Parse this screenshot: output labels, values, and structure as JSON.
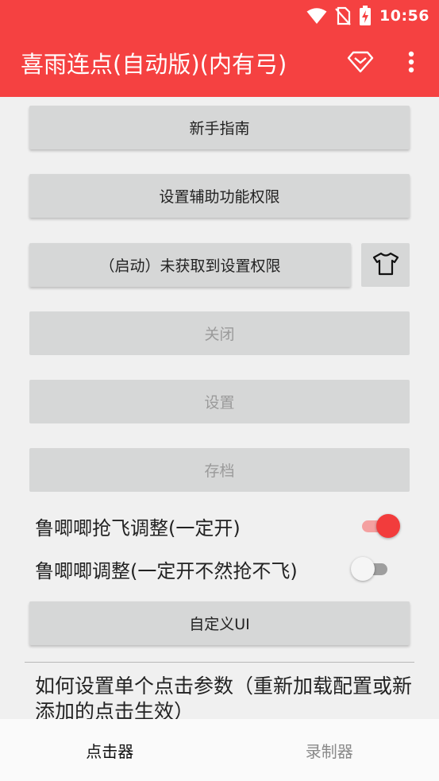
{
  "status_bar": {
    "time": "10:56",
    "icons": [
      "wifi-icon",
      "no-sim-icon",
      "battery-charging-icon"
    ]
  },
  "app_bar": {
    "title": "喜雨连点(自动版)(内有弓)",
    "actions": [
      "diamond-vip-icon",
      "more-vert-icon"
    ]
  },
  "buttons": {
    "guide": "新手指南",
    "accessibility": "设置辅助功能权限",
    "start": "（启动）未获取到设置权限",
    "close": "关闭",
    "settings": "设置",
    "archive": "存档",
    "custom_ui": "自定义UI"
  },
  "switches": [
    {
      "label": "鲁唧唧抢飞调整(一定开)",
      "on": true
    },
    {
      "label": "鲁唧唧调整(一定开不然抢不飞)",
      "on": false
    }
  ],
  "help": {
    "text": "如何设置单个点击参数（重新加载配置或新添加的点击生效）"
  },
  "bottom_nav": {
    "tabs": [
      {
        "label": "点击器",
        "active": true
      },
      {
        "label": "录制器",
        "active": false
      }
    ]
  },
  "colors": {
    "primary": "#f54141",
    "switch_on_thumb": "#f23c3c",
    "switch_on_track": "#f4a0a0",
    "switch_off_thumb": "#f5f5f5",
    "switch_off_track": "#9e9e9e",
    "button_bg": "#d6d7d7"
  }
}
